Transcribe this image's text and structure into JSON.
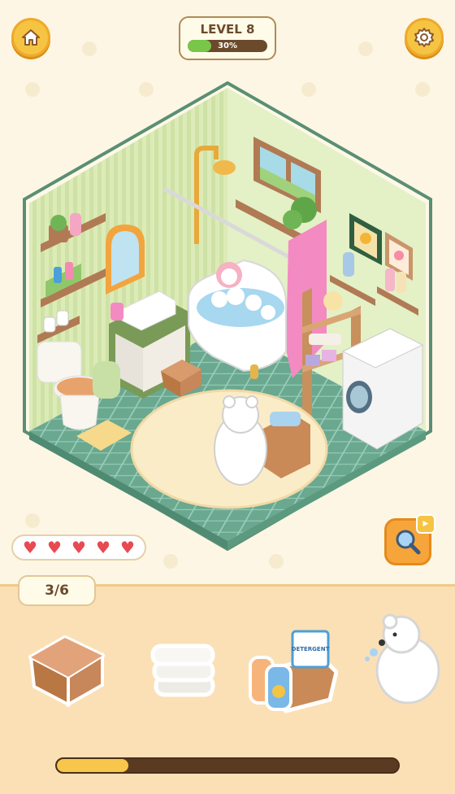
{
  "header": {
    "level_label": "LEVEL 8",
    "level_progress_text": "30%",
    "level_progress": 0.3
  },
  "icons": {
    "home": "home-icon",
    "settings": "gear-icon",
    "magnify": "magnifier-icon",
    "video": "play-icon"
  },
  "lives": {
    "hearts": 5,
    "glyph": "♥"
  },
  "found": {
    "counter": "3/6"
  },
  "items": [
    {
      "name": "wooden-stool"
    },
    {
      "name": "folded-towels"
    },
    {
      "name": "detergent-basket",
      "label": "DETERGENT"
    },
    {
      "name": "polar-bear"
    }
  ],
  "bottom_progress": 0.21,
  "colors": {
    "accent": "#f6c443",
    "tray": "#fbe0b6",
    "floor": "#6aa890",
    "wall": "#d9ecb6",
    "heart": "#e84a52"
  }
}
